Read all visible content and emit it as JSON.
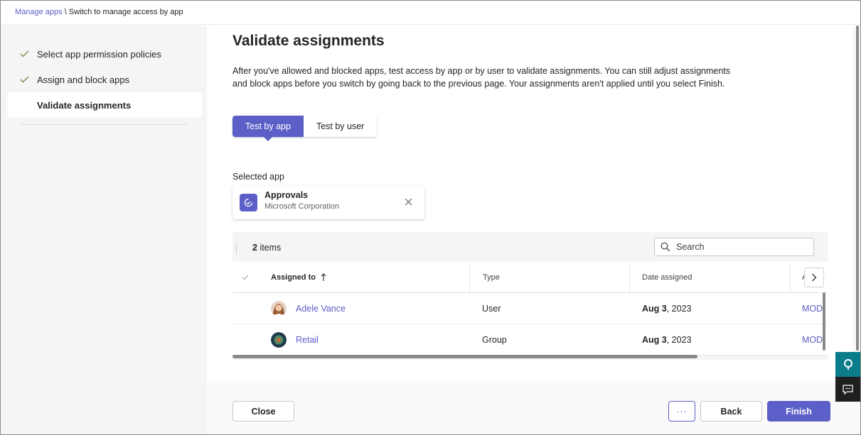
{
  "breadcrumb": {
    "parent": "Manage apps",
    "separator": " \\ ",
    "current": "Switch to manage access by app"
  },
  "steps": [
    {
      "label": "Select app permission policies",
      "done": true
    },
    {
      "label": "Assign and block apps",
      "done": true
    },
    {
      "label": "Validate assignments",
      "done": false,
      "active": true
    }
  ],
  "page": {
    "title": "Validate assignments",
    "description": "After you've allowed and blocked apps, test access by app or by user to validate assignments. You can still adjust assignments and block apps before you switch by going back to the previous page. Your assignments aren't applied until you select Finish."
  },
  "toggle": {
    "by_app": "Test by app",
    "by_user": "Test by user",
    "selected": "Test by app"
  },
  "selected_app": {
    "label": "Selected app",
    "name": "Approvals",
    "publisher": "Microsoft Corporation",
    "icon": "approvals-icon"
  },
  "table": {
    "count": "2",
    "count_suffix": " items",
    "search_placeholder": "Search",
    "columns": {
      "assigned_to": "Assigned to",
      "type": "Type",
      "date": "Date assigned",
      "partial": "A"
    },
    "rows": [
      {
        "name": "Adele Vance",
        "type": "User",
        "date_bold": "Aug 3",
        "date_rest": ", 2023",
        "extra": "MOD"
      },
      {
        "name": "Retail",
        "type": "Group",
        "date_bold": "Aug 3",
        "date_rest": ", 2023",
        "extra": "MOD"
      }
    ]
  },
  "footer": {
    "close": "Close",
    "more": "···",
    "back": "Back",
    "finish": "Finish"
  },
  "colors": {
    "accent": "#5b5fc7",
    "side_float_top": "#0b7d8a",
    "side_float_bottom": "#1f1f1f"
  }
}
